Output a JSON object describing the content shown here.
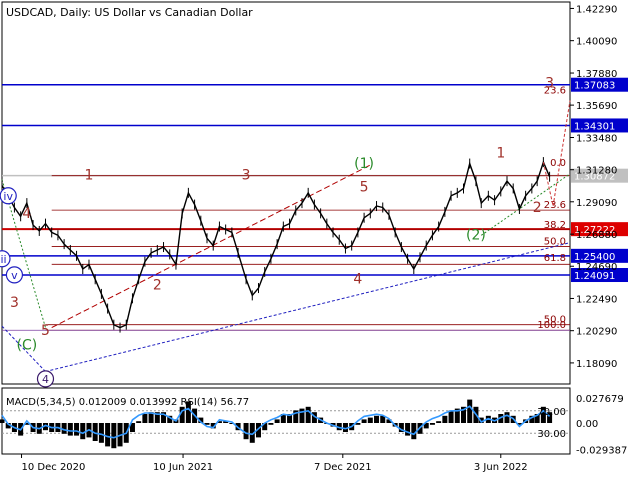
{
  "chart_data": {
    "type": "line",
    "title": "USDCAD, Daily:  US Dollar vs Canadian Dollar",
    "price_axis": {
      "ticks": [
        "1.42290",
        "1.40090",
        "1.37880",
        "1.35690",
        "1.33480",
        "1.31280",
        "1.29090",
        "1.26880",
        "1.24690",
        "1.22490",
        "1.20290",
        "1.18090"
      ],
      "ylim": [
        1.1665,
        1.4273
      ]
    },
    "date_axis": {
      "ticks": [
        "10 Dec 2020",
        "10 Jun 2021",
        "7 Dec 2021",
        "3 Jun 2022"
      ],
      "xlim": [
        "2020-11-18",
        "2022-08-20"
      ]
    },
    "series": [
      {
        "name": "USDCAD",
        "x": [
          "2020-11-18",
          "2020-11-25",
          "2020-12-02",
          "2020-12-09",
          "2020-12-16",
          "2020-12-23",
          "2020-12-30",
          "2021-01-06",
          "2021-01-13",
          "2021-01-20",
          "2021-01-27",
          "2021-02-03",
          "2021-02-10",
          "2021-02-17",
          "2021-02-24",
          "2021-03-03",
          "2021-03-10",
          "2021-03-17",
          "2021-03-24",
          "2021-03-31",
          "2021-04-07",
          "2021-04-14",
          "2021-04-21",
          "2021-04-28",
          "2021-05-05",
          "2021-05-12",
          "2021-05-19",
          "2021-05-26",
          "2021-06-02",
          "2021-06-09",
          "2021-06-16",
          "2021-06-23",
          "2021-06-30",
          "2021-07-07",
          "2021-07-14",
          "2021-07-21",
          "2021-07-28",
          "2021-08-04",
          "2021-08-11",
          "2021-08-20",
          "2021-08-27",
          "2021-09-03",
          "2021-09-10",
          "2021-09-17",
          "2021-09-24",
          "2021-10-01",
          "2021-10-08",
          "2021-10-15",
          "2021-10-22",
          "2021-10-29",
          "2021-11-05",
          "2021-11-12",
          "2021-11-19",
          "2021-11-26",
          "2021-12-03",
          "2021-12-10",
          "2021-12-17",
          "2021-12-24",
          "2021-12-31",
          "2022-01-07",
          "2022-01-14",
          "2022-01-21",
          "2022-01-28",
          "2022-02-04",
          "2022-02-11",
          "2022-02-18",
          "2022-02-25",
          "2022-03-04",
          "2022-03-11",
          "2022-03-18",
          "2022-03-25",
          "2022-04-01",
          "2022-04-08",
          "2022-04-15",
          "2022-04-22",
          "2022-04-29",
          "2022-05-06",
          "2022-05-12",
          "2022-05-20",
          "2022-05-27",
          "2022-06-03",
          "2022-06-10",
          "2022-06-17",
          "2022-06-24",
          "2022-07-01",
          "2022-07-08",
          "2022-07-14",
          "2022-07-21",
          "2022-07-28"
        ],
        "values": [
          1.302,
          1.295,
          1.287,
          1.281,
          1.29,
          1.275,
          1.271,
          1.276,
          1.27,
          1.268,
          1.262,
          1.258,
          1.254,
          1.245,
          1.248,
          1.238,
          1.228,
          1.218,
          1.207,
          1.205,
          1.207,
          1.225,
          1.238,
          1.25,
          1.256,
          1.258,
          1.26,
          1.255,
          1.248,
          1.283,
          1.297,
          1.289,
          1.278,
          1.266,
          1.261,
          1.274,
          1.272,
          1.27,
          1.256,
          1.238,
          1.227,
          1.232,
          1.243,
          1.252,
          1.262,
          1.274,
          1.276,
          1.285,
          1.29,
          1.297,
          1.289,
          1.283,
          1.276,
          1.27,
          1.265,
          1.259,
          1.261,
          1.27,
          1.28,
          1.283,
          1.288,
          1.287,
          1.282,
          1.27,
          1.26,
          1.252,
          1.245,
          1.253,
          1.261,
          1.268,
          1.274,
          1.284,
          1.295,
          1.297,
          1.3,
          1.317,
          1.305,
          1.29,
          1.295,
          1.292,
          1.298,
          1.305,
          1.3,
          1.286,
          1.295,
          1.3,
          1.305,
          1.318,
          1.308
        ]
      }
    ],
    "levels": [
      {
        "label": "1.37083",
        "value": 1.37083,
        "color": "#0000cc",
        "label_bg": "#0000cc"
      },
      {
        "label": "1.34301",
        "value": 1.34301,
        "color": "#0000cc",
        "label_bg": "#0000cc"
      },
      {
        "label": "1.30872",
        "value": 1.30872,
        "color": "#c0c0c0",
        "label_bg": "#c0c0c0"
      },
      {
        "label": "1.27222",
        "value": 1.27222,
        "color": "#cc0000",
        "label_bg": "#dd0000"
      },
      {
        "label": "1.25400",
        "value": 1.254,
        "color": "#0000cc",
        "label_bg": "#0000cc"
      },
      {
        "label": "1.24091",
        "value": 1.24091,
        "color": "#0000cc",
        "label_bg": "#0000cc"
      }
    ],
    "fib_left": [
      {
        "label": "0.0",
        "value": 1.30872,
        "x_from": "2021-01-13"
      },
      {
        "label": "23.6",
        "value": 1.2852,
        "x_from": "2021-01-13"
      },
      {
        "label": "38.2",
        "value": 1.27222,
        "x_from": "2021-01-13"
      },
      {
        "label": "50.0",
        "value": 1.2604,
        "x_from": "2021-01-13"
      },
      {
        "label": "61.8",
        "value": 1.2482,
        "x_from": "2021-01-13"
      }
    ],
    "fib_right_labels": [
      {
        "label": "23.6",
        "value": 1.3634
      },
      {
        "label": "0.0",
        "value": 1.314
      },
      {
        "label": "23.6",
        "value": 1.2852
      },
      {
        "label": "38.2",
        "value": 1.2715
      },
      {
        "label": "50.0",
        "value": 1.2604
      },
      {
        "label": "61.8",
        "value": 1.249
      },
      {
        "label": "50.0",
        "value": 1.207
      },
      {
        "label": "100.0",
        "value": 1.2032
      }
    ],
    "wave_labels_red": [
      {
        "label": "1",
        "x": "2021-02-24",
        "y": 1.306
      },
      {
        "label": "2",
        "x": "2021-05-12",
        "y": 1.231
      },
      {
        "label": "3",
        "x": "2021-08-20",
        "y": 1.306
      },
      {
        "label": "4",
        "x": "2021-12-24",
        "y": 1.235
      },
      {
        "label": "5",
        "x": "2021-12-31",
        "y": 1.298
      },
      {
        "label": "4",
        "x": "2020-12-16",
        "y": 1.28
      },
      {
        "label": "3",
        "x": "2020-12-02",
        "y": 1.219
      },
      {
        "label": "5",
        "x": "2021-01-06",
        "y": 1.2
      },
      {
        "label": "1",
        "x": "2022-06-03",
        "y": 1.321
      },
      {
        "label": "2",
        "x": "2022-07-14",
        "y": 1.284
      },
      {
        "label": "3",
        "x": "2022-07-28",
        "y": 1.369
      }
    ],
    "wave_labels_green": [
      {
        "label": "(1)",
        "x": "2021-12-31",
        "y": 1.314
      },
      {
        "label": "(2)",
        "x": "2022-05-06",
        "y": 1.265
      },
      {
        "label": "(C)",
        "x": "2020-12-16",
        "y": 1.19
      }
    ],
    "wave_labels_circled": [
      {
        "label": "iv",
        "x": "2020-11-25",
        "y": 1.295
      },
      {
        "label": "iii",
        "x": "2020-11-18",
        "y": 1.252
      },
      {
        "label": "v",
        "x": "2020-12-02",
        "y": 1.241
      },
      {
        "label": "4",
        "x": "2021-01-06",
        "y": 1.17
      }
    ],
    "projection_red": {
      "x": [
        "2022-07-21",
        "2022-08-01",
        "2022-08-20"
      ],
      "values": [
        1.318,
        1.288,
        1.36
      ]
    },
    "indicator": {
      "label": "MACD(5,34,5) 0.012009 0.013992 RSI(14) 56.77",
      "ticks_left": [
        "70.00",
        "30.00"
      ],
      "ticks_right": [
        "0.027679",
        "0.00",
        "-0.029387"
      ],
      "histogram": [
        0.004,
        -0.006,
        -0.01,
        -0.014,
        -0.002,
        -0.01,
        -0.012,
        -0.008,
        -0.01,
        -0.01,
        -0.012,
        -0.014,
        -0.014,
        -0.018,
        -0.016,
        -0.02,
        -0.022,
        -0.026,
        -0.028,
        -0.026,
        -0.022,
        -0.01,
        0.002,
        0.01,
        0.012,
        0.012,
        0.012,
        0.008,
        0.004,
        0.018,
        0.024,
        0.016,
        0.006,
        -0.002,
        -0.006,
        0.002,
        0.002,
        0.0,
        -0.008,
        -0.018,
        -0.022,
        -0.016,
        -0.008,
        -0.002,
        0.004,
        0.01,
        0.01,
        0.014,
        0.016,
        0.018,
        0.012,
        0.006,
        0.0,
        -0.004,
        -0.008,
        -0.01,
        -0.008,
        -0.002,
        0.004,
        0.006,
        0.008,
        0.008,
        0.004,
        -0.004,
        -0.01,
        -0.014,
        -0.018,
        -0.012,
        -0.006,
        -0.002,
        0.002,
        0.008,
        0.014,
        0.016,
        0.018,
        0.026,
        0.018,
        0.006,
        0.008,
        0.006,
        0.01,
        0.012,
        0.008,
        -0.002,
        0.004,
        0.008,
        0.01,
        0.018,
        0.012
      ],
      "rsi": [
        62,
        46,
        40,
        36,
        52,
        40,
        38,
        44,
        40,
        40,
        36,
        34,
        34,
        30,
        36,
        30,
        28,
        24,
        22,
        26,
        30,
        54,
        62,
        66,
        66,
        64,
        64,
        58,
        52,
        70,
        74,
        62,
        50,
        42,
        40,
        54,
        52,
        50,
        40,
        30,
        28,
        38,
        48,
        54,
        58,
        64,
        62,
        66,
        68,
        70,
        60,
        54,
        48,
        44,
        40,
        38,
        42,
        52,
        60,
        62,
        64,
        62,
        56,
        44,
        36,
        32,
        28,
        40,
        50,
        56,
        60,
        66,
        70,
        70,
        72,
        78,
        64,
        50,
        56,
        52,
        58,
        62,
        56,
        42,
        52,
        58,
        62,
        70,
        60
      ]
    }
  }
}
